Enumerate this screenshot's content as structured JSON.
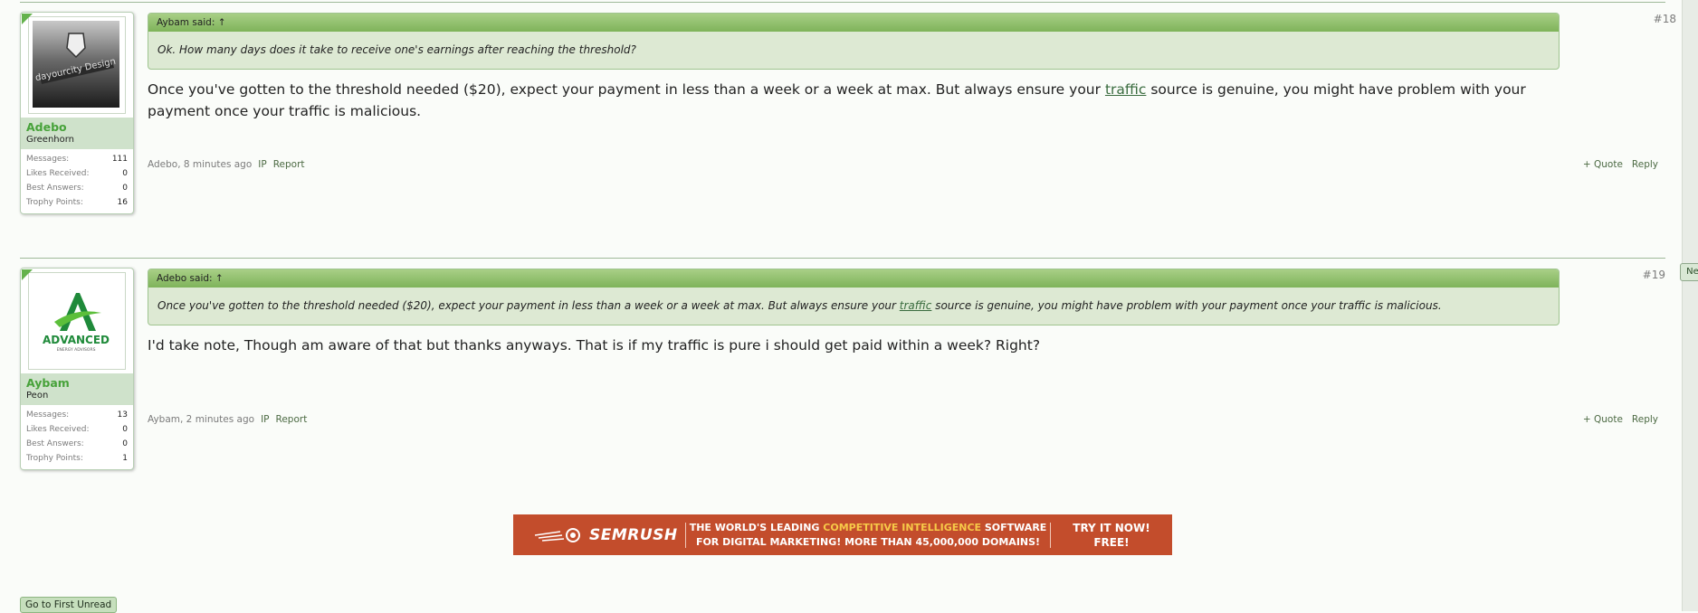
{
  "posts": [
    {
      "number": "#18",
      "user": {
        "name": "Adebo",
        "title": "Greenhorn"
      },
      "stats": [
        {
          "label": "Messages:",
          "value": "111"
        },
        {
          "label": "Likes Received:",
          "value": "0"
        },
        {
          "label": "Best Answers:",
          "value": "0"
        },
        {
          "label": "Trophy Points:",
          "value": "16"
        }
      ],
      "quote": {
        "header": "Aybam said: ↑",
        "body": "Ok. How many days does it take to receive one's earnings after reaching the threshold?"
      },
      "message": {
        "before": "Once you've gotten to the threshold needed ($20), expect your payment in less than a week or a week at max. But always ensure your ",
        "link": "traffic",
        "after": " source is genuine, you might have problem with your payment once your traffic is malicious."
      },
      "meta": "Adebo, 8 minutes ago",
      "ip": "IP",
      "report": "Report",
      "quote_btn": "+ Quote",
      "reply": "Reply"
    },
    {
      "number": "#19",
      "new_badge": "New",
      "user": {
        "name": "Aybam",
        "title": "Peon"
      },
      "stats": [
        {
          "label": "Messages:",
          "value": "13"
        },
        {
          "label": "Likes Received:",
          "value": "0"
        },
        {
          "label": "Best Answers:",
          "value": "0"
        },
        {
          "label": "Trophy Points:",
          "value": "1"
        }
      ],
      "quote": {
        "header": "Adebo said: ↑",
        "before": "Once you've gotten to the threshold needed ($20), expect your payment in less than a week or a week at max. But always ensure your ",
        "link": "traffic",
        "after": " source is genuine, you might have problem with your payment once your traffic is malicious."
      },
      "message": "I'd take note, Though am aware of that but thanks anyways. That is if my traffic is pure i should get paid within a week? Right?",
      "meta": "Aybam, 2 minutes ago",
      "ip": "IP",
      "report": "Report",
      "quote_btn": "+ Quote",
      "reply": "Reply"
    }
  ],
  "ad": {
    "brand": "SEMRUSH",
    "line1_pre": "THE WORLD'S LEADING ",
    "line1_hl": "COMPETITIVE INTELLIGENCE",
    "line1_post": " SOFTWARE",
    "line2": "FOR DIGITAL MARKETING! MORE THAN 45,000,000 DOMAINS!",
    "cta1": "TRY IT NOW!",
    "cta2": "FREE!",
    "colors": {
      "background": "#c34d2c",
      "highlight": "#f7c948"
    }
  },
  "first_unread": "Go to First Unread",
  "colors": {
    "accent": "#47a23a",
    "quote_header": "#8fbf6a",
    "quote_body": "#dde9d3"
  },
  "avatars": {
    "adebo": "dark-design-logo-avatar",
    "aybam": "advanced-energy-advisors-logo-avatar"
  },
  "avatar_texts": {
    "aybam_logo": "ADVANCED",
    "aybam_sub": "ENERGY ADVISORS"
  }
}
